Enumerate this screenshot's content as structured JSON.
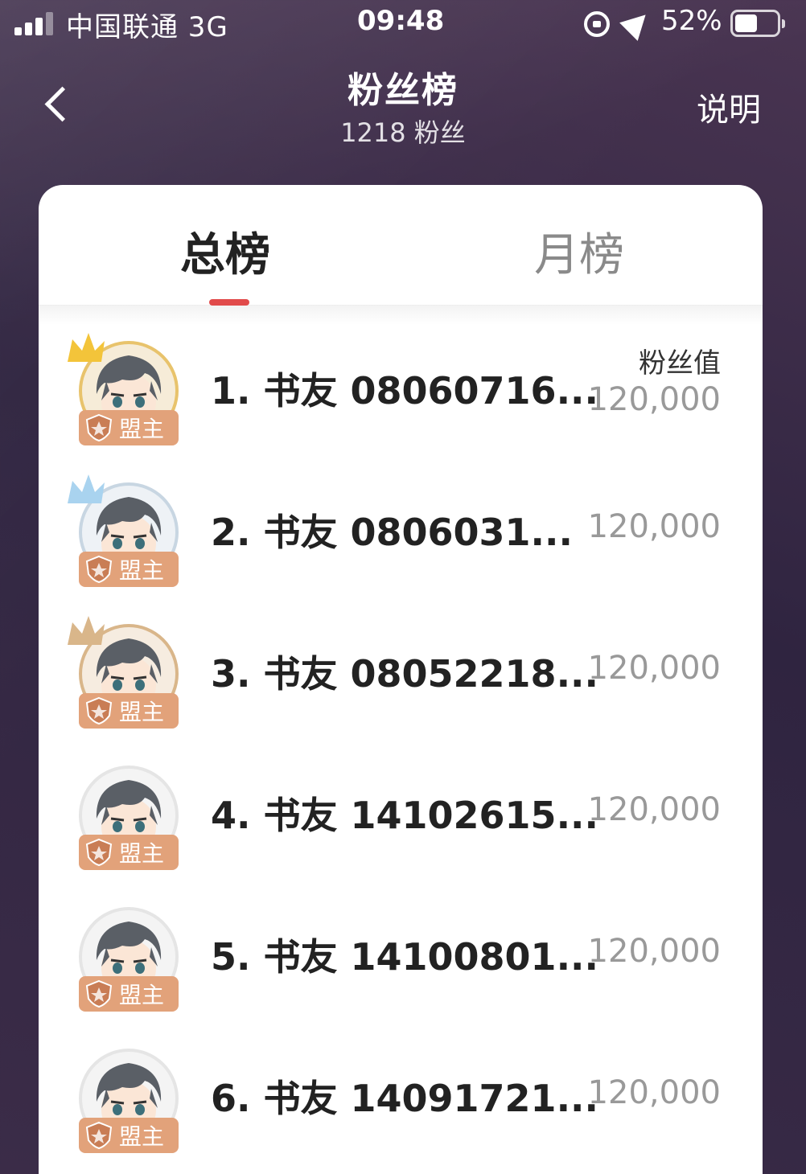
{
  "status_bar": {
    "carrier": "中国联通 3G",
    "time": "09:48",
    "battery": "52%"
  },
  "header": {
    "title": "粉丝榜",
    "subtitle": "1218 粉丝",
    "explain_label": "说明"
  },
  "tabs": [
    {
      "label": "总榜",
      "active": true
    },
    {
      "label": "月榜",
      "active": false
    }
  ],
  "list": {
    "score_header": "粉丝值",
    "badge_label": "盟主",
    "rows": [
      {
        "name": "1. 书友 08060716...",
        "score": "120,000",
        "crown": "gold"
      },
      {
        "name": "2. 书友 0806031...",
        "score": "120,000",
        "crown": "silver"
      },
      {
        "name": "3. 书友 08052218...",
        "score": "120,000",
        "crown": "bronze"
      },
      {
        "name": "4. 书友 14102615...",
        "score": "120,000",
        "crown": "none"
      },
      {
        "name": "5. 书友 14100801...",
        "score": "120,000",
        "crown": "none"
      },
      {
        "name": "6. 书友 14091721...",
        "score": "120,000",
        "crown": "none"
      }
    ]
  },
  "colors": {
    "accent": "#e14b4b",
    "badge": "#e2a27a",
    "gold_crown": "#f3c43a",
    "silver_crown": "#a9d3ef",
    "bronze_crown": "#d9b68a"
  }
}
